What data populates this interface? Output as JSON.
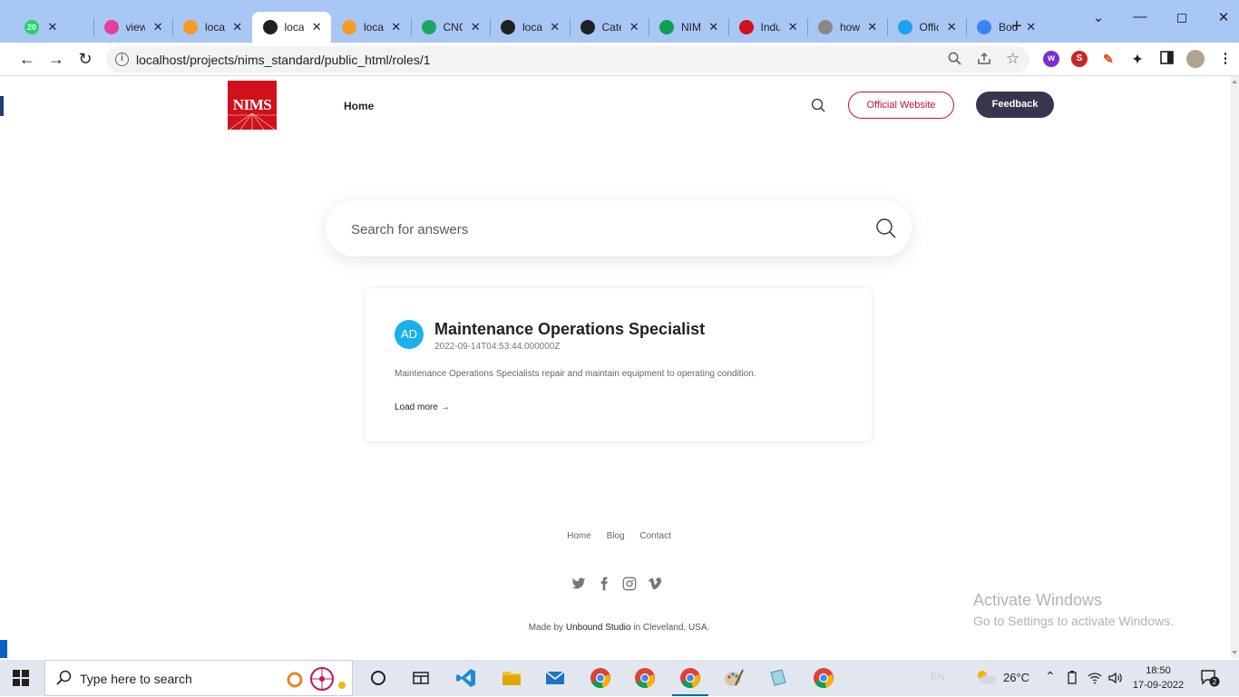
{
  "browser": {
    "tabs": [
      {
        "title": "",
        "badge": "20",
        "icon": "whatsapp-icon",
        "color": "#25d366"
      },
      {
        "title": "view",
        "badge": "",
        "icon": "gitlab-icon",
        "color": "#e4409b"
      },
      {
        "title": "local",
        "badge": "",
        "icon": "phpmyadmin-icon",
        "color": "#f59b27"
      },
      {
        "title": "local",
        "badge": "",
        "icon": "globe-icon",
        "color": "#202124",
        "active": true
      },
      {
        "title": "local",
        "badge": "",
        "icon": "phpmyadmin-icon",
        "color": "#f59b27"
      },
      {
        "title": "CNC",
        "badge": "",
        "icon": "google-drive-icon",
        "color": "#1fa463"
      },
      {
        "title": "local",
        "badge": "",
        "icon": "globe-icon",
        "color": "#202124"
      },
      {
        "title": "Cate",
        "badge": "",
        "icon": "zendesk-icon",
        "color": "#202124"
      },
      {
        "title": "NIM",
        "badge": "",
        "icon": "sheets-icon",
        "color": "#0f9d58"
      },
      {
        "title": "Indu",
        "badge": "",
        "icon": "nims-icon",
        "color": "#d0111b"
      },
      {
        "title": "how",
        "badge": "",
        "icon": "figma-icon",
        "color": "#888888"
      },
      {
        "title": "Offic",
        "badge": "",
        "icon": "bootstrap-icon",
        "color": "#1da1f2"
      },
      {
        "title": "Boot",
        "badge": "",
        "icon": "checkmark-icon",
        "color": "#3b82f6"
      }
    ],
    "url": "localhost/projects/nims_standard/public_html/roles/1"
  },
  "site": {
    "logo_text": "NIMS",
    "nav_home": "Home",
    "official_button": "Official Website",
    "feedback_button": "Feedback",
    "search_placeholder": "Search for answers"
  },
  "card": {
    "avatar": "AD",
    "title": "Maintenance Operations Specialist",
    "date": "2022-09-14T04:53:44.000000Z",
    "description": "Maintenance Operations Specialists repair and maintain equipment to operating condition.",
    "more": "Load more →"
  },
  "footer": {
    "links": [
      "Home",
      "Blog",
      "Contact"
    ],
    "socials": [
      "twitter-icon",
      "facebook-icon",
      "instagram-icon",
      "vimeo-icon"
    ],
    "made_by_prefix": "Made by",
    "studio": "Unbound Studio",
    "made_by_suffix": "in Cleveland, USA."
  },
  "watermark": {
    "line1": "Activate Windows",
    "line2": "Go to Settings to activate Windows."
  },
  "taskbar": {
    "search_placeholder": "Type here to search",
    "language": "EN",
    "temperature": "26°C",
    "time": "18:50",
    "date": "17-09-2022",
    "notifications": "2"
  },
  "colors": {
    "brand_red": "#d0111b",
    "feedback_bg": "#38364f",
    "avatar_bg": "#1ab0ec",
    "tabbar_bg": "#a9c7f5"
  }
}
